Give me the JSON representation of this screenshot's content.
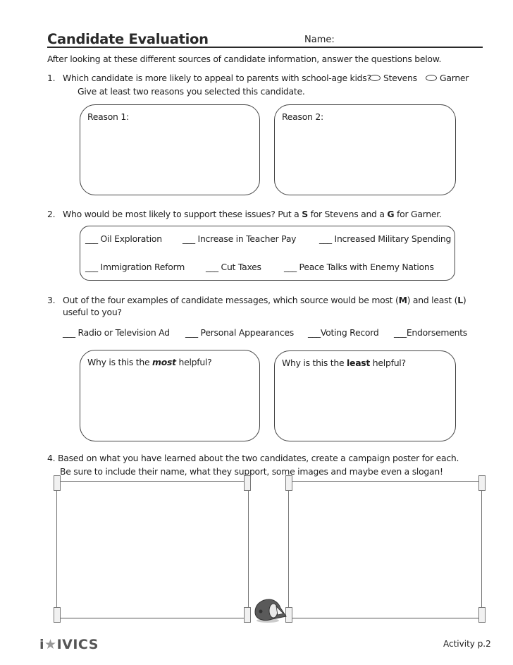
{
  "header": {
    "title": "Candidate Evaluation",
    "name_label": "Name:"
  },
  "intro": "After looking at these different sources of candidate information, answer the questions below.",
  "q1": {
    "number": "1.",
    "text": "Which candidate is more likely to appeal to parents with school-age kids?",
    "options": [
      "Stevens",
      "Garner"
    ],
    "subtext": "Give at least two reasons you selected this candidate.",
    "boxes": [
      "Reason 1:",
      "Reason 2:"
    ]
  },
  "q2": {
    "number": "2.",
    "text_pre": "Who would be most likely to support these issues? Put a ",
    "s_letter": "S",
    "text_mid": " for Stevens and a ",
    "g_letter": "G",
    "text_post": " for Garner.",
    "blank": "___",
    "issues": [
      "Oil Exploration",
      "Increase in Teacher Pay",
      "Increased Military Spending",
      "Immigration Reform",
      "Cut Taxes",
      "Peace Talks with Enemy Nations"
    ]
  },
  "q3": {
    "number": "3.",
    "text_pre": "Out of the four examples of candidate messages, which source would be most (",
    "m_letter": "M",
    "text_mid": ") and least (",
    "l_letter": "L",
    "text_post": ")",
    "text_line2": "useful to you?",
    "blank": "___",
    "sources": [
      "Radio or Television Ad",
      "Personal Appearances",
      "Voting Record",
      "Endorsements"
    ],
    "box_most": {
      "pre": "Why is this the ",
      "emph": "most",
      "post": " helpful?"
    },
    "box_least": {
      "pre": "Why is this the ",
      "emph": "least",
      "post": " helpful?"
    }
  },
  "q4": {
    "text": "4. Based on what you have learned about the two candidates, create a campaign poster for each.",
    "subtext": "Be sure to include their name, what they support, some images and maybe even a slogan!"
  },
  "footer": {
    "logo_i": "i",
    "logo_star": "★",
    "logo_rest": "IVICS",
    "page": "Activity p.2"
  }
}
